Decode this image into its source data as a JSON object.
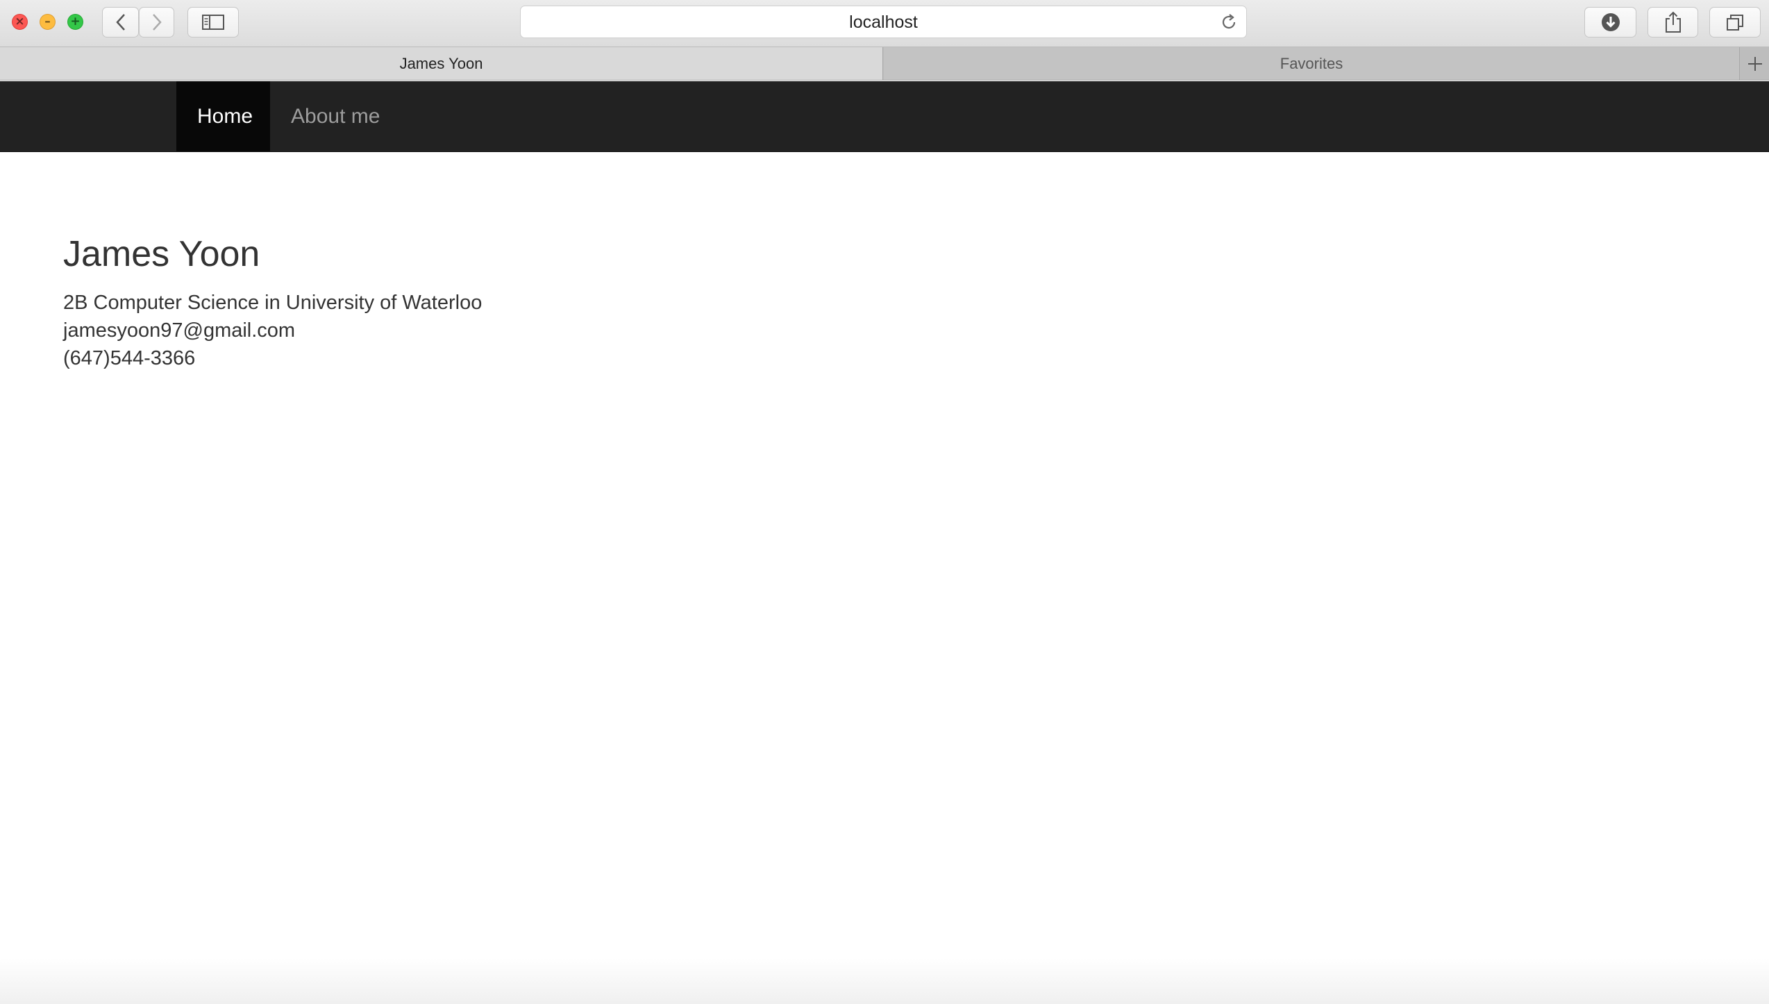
{
  "browser": {
    "url": "localhost",
    "tabs": [
      {
        "label": "James Yoon",
        "active": true
      },
      {
        "label": "Favorites",
        "active": false
      }
    ],
    "icons": [
      "close-icon",
      "minimize-icon",
      "maximize-icon",
      "back-icon",
      "forward-icon",
      "sidebar-icon",
      "reload-icon",
      "download-icon",
      "share-icon",
      "tabs-overview-icon",
      "new-tab-icon"
    ]
  },
  "navbar": {
    "items": [
      {
        "label": "Home",
        "active": true
      },
      {
        "label": "About me",
        "active": false
      }
    ],
    "colors": {
      "background": "#222222",
      "active_bg": "#080808",
      "link": "#9d9d9d"
    }
  },
  "profile": {
    "name": "James Yoon",
    "program": "2B Computer Science in University of Waterloo",
    "email": "jamesyoon97@gmail.com",
    "phone": "(647)544-3366"
  }
}
